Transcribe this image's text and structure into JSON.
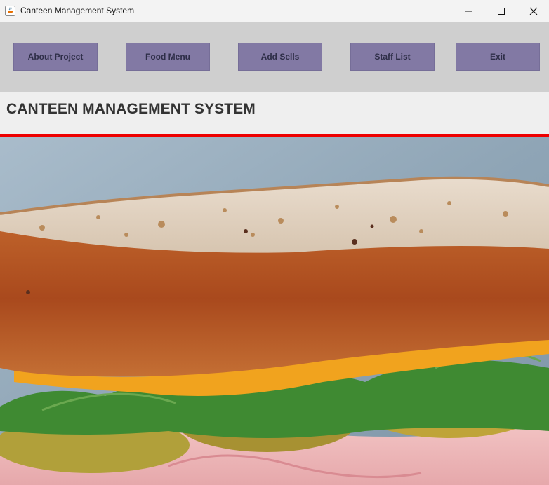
{
  "window": {
    "title": "Canteen Management System"
  },
  "toolbar": {
    "buttons": [
      "About Project",
      "Food Menu",
      "Add Sells",
      "Staff List",
      "Exit"
    ]
  },
  "header": {
    "title": "CANTEEN MANAGEMENT SYSTEM"
  },
  "image": {
    "subject": "sandwich-photo"
  },
  "colors": {
    "button_bg": "#8279a4",
    "toolbar_bg": "#cfcfcf",
    "accent_line": "#ee0000"
  }
}
